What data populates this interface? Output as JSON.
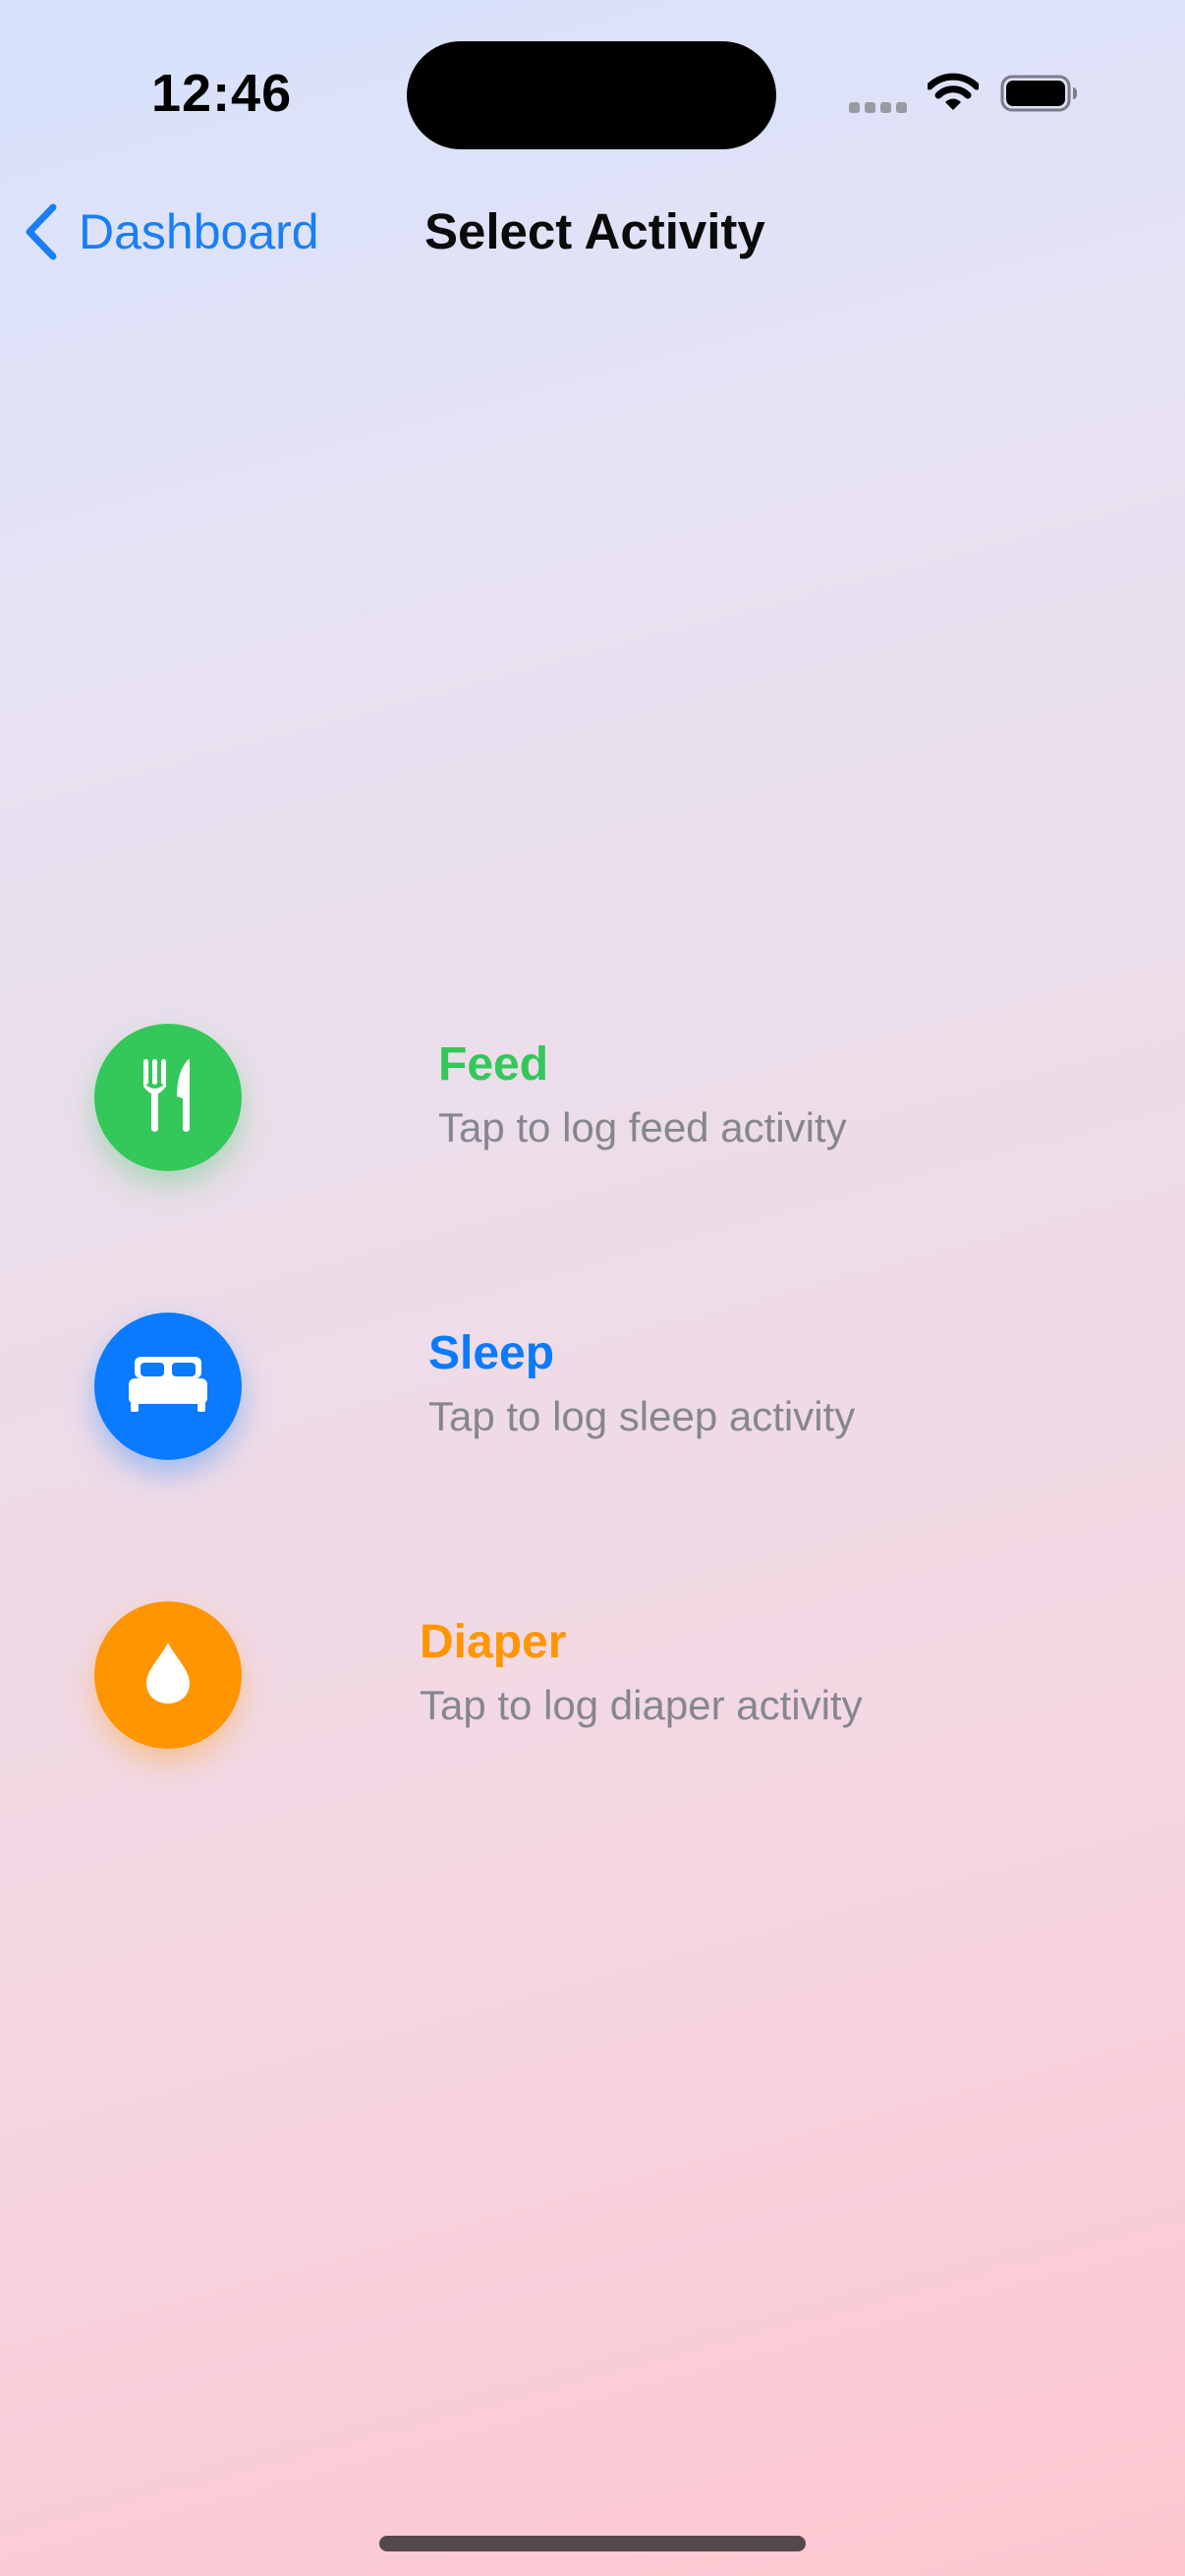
{
  "status_bar": {
    "time": "12:46",
    "icons": [
      "signal-icon",
      "wifi-icon",
      "battery-icon"
    ]
  },
  "nav": {
    "back_label": "Dashboard",
    "back_icon": "chevron-left-icon",
    "title": "Select Activity"
  },
  "activities": [
    {
      "title": "Feed",
      "subtitle": "Tap to log feed activity",
      "icon": "fork-knife-icon",
      "color": "#34c759"
    },
    {
      "title": "Sleep",
      "subtitle": "Tap to log sleep activity",
      "icon": "bed-icon",
      "color": "#0a7aff"
    },
    {
      "title": "Diaper",
      "subtitle": "Tap to log diaper activity",
      "icon": "drop-icon",
      "color": "#ff9500"
    }
  ],
  "colors": {
    "accent": "#1a7ef5",
    "subtitle": "#86868e"
  }
}
